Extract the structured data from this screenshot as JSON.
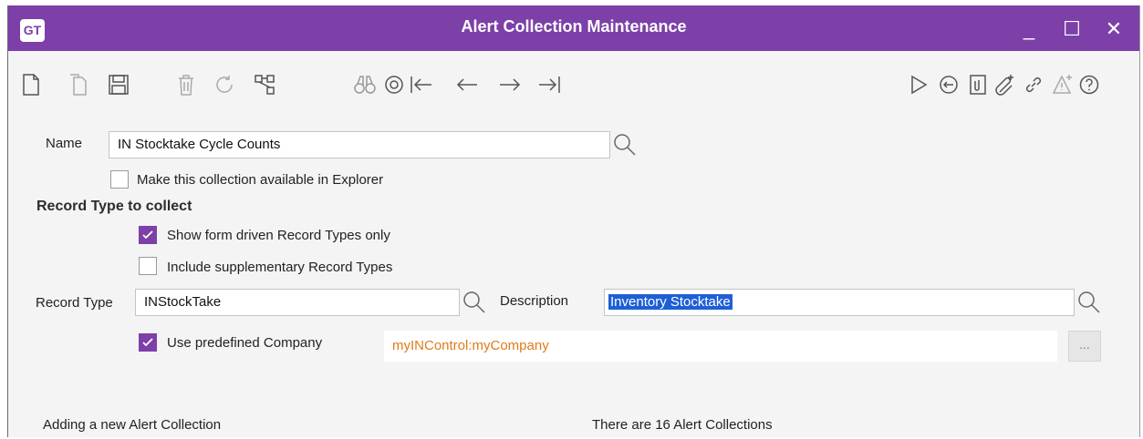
{
  "window": {
    "logo": "GT",
    "title": "Alert Collection Maintenance",
    "controls": {
      "minimize": "_",
      "maximize": "☐",
      "close": "✕"
    }
  },
  "toolbar": {
    "left": [
      "new-document-icon",
      "copy-document-icon",
      "save-icon",
      "delete-icon",
      "refresh-icon",
      "hierarchy-icon"
    ],
    "nav": [
      "binoculars-icon",
      "goto-icon",
      "first-record-icon",
      "previous-record-icon",
      "next-record-icon",
      "last-record-icon"
    ],
    "right": [
      "run-icon",
      "back-circle-icon",
      "attach-document-icon",
      "attach-add-icon",
      "link-icon",
      "alert-add-icon",
      "help-icon"
    ]
  },
  "form": {
    "name_label": "Name",
    "name_value": "IN Stocktake Cycle Counts",
    "explorer_label": "Make this collection available in Explorer",
    "explorer_checked": false,
    "section_title": "Record Type to collect",
    "form_driven_label": "Show form driven Record Types only",
    "form_driven_checked": true,
    "supplementary_label": "Include supplementary Record Types",
    "supplementary_checked": false,
    "record_type_label": "Record Type",
    "record_type_value": "INStockTake",
    "description_label": "Description",
    "description_value": "Inventory Stocktake",
    "predefined_label": "Use predefined Company",
    "predefined_checked": true,
    "predefined_value": "myINControl:myCompany",
    "ellipsis_label": "..."
  },
  "status": {
    "left": "Adding a new Alert Collection",
    "right": "There are 16 Alert Collections"
  },
  "colors": {
    "accent": "#7d3fa8",
    "selection": "#1e5fd6",
    "readonly_text": "#e07b1a"
  }
}
